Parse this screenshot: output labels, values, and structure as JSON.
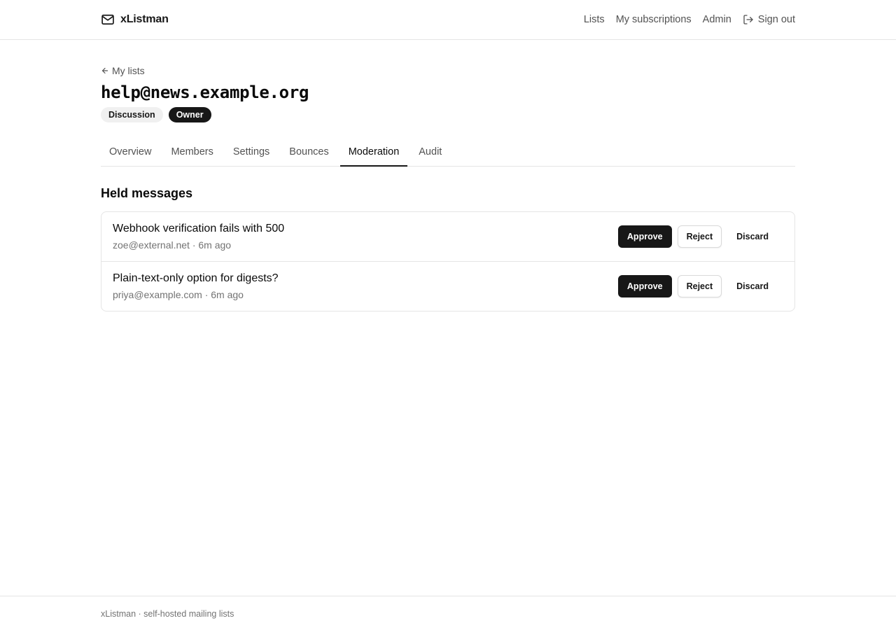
{
  "header": {
    "brand": "xListman",
    "nav": [
      {
        "label": "Lists"
      },
      {
        "label": "My subscriptions"
      },
      {
        "label": "Admin"
      }
    ],
    "signout_label": "Sign out"
  },
  "page": {
    "back_label": "My lists",
    "title": "help@news.example.org",
    "badges": [
      {
        "label": "Discussion"
      },
      {
        "label": "Owner"
      }
    ],
    "tabs": [
      {
        "label": "Overview",
        "active": false
      },
      {
        "label": "Members",
        "active": false
      },
      {
        "label": "Settings",
        "active": false
      },
      {
        "label": "Bounces",
        "active": false
      },
      {
        "label": "Moderation",
        "active": true
      },
      {
        "label": "Audit",
        "active": false
      }
    ],
    "section_title": "Held messages",
    "messages": [
      {
        "subject": "Webhook verification fails with 500",
        "meta": "zoe@external.net · 6m ago",
        "approve": "Approve",
        "reject": "Reject",
        "discard": "Discard"
      },
      {
        "subject": "Plain-text-only option for digests?",
        "meta": "priya@example.com · 6m ago",
        "approve": "Approve",
        "reject": "Reject",
        "discard": "Discard"
      }
    ]
  },
  "footer": {
    "text": "xListman · self-hosted mailing lists"
  },
  "icons": {
    "brand": "mail-icon",
    "signout": "log-out-icon",
    "back": "arrow-left-icon"
  },
  "colors": {
    "primary": "#171717",
    "muted_text": "#525252",
    "border": "#e5e5e5"
  }
}
